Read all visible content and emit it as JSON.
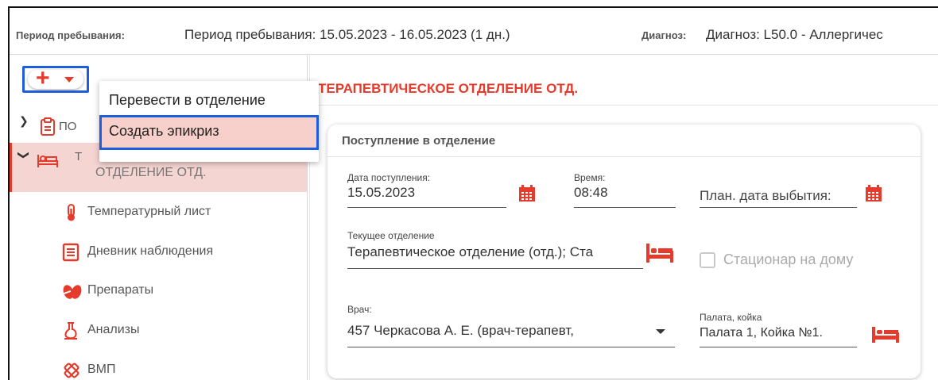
{
  "header": {
    "period_label": "Период пребывания:",
    "period_value": "Период пребывания: 15.05.2023 - 16.05.2023 (1 дн.)",
    "diagnosis_label": "Диагноз:",
    "diagnosis_value": "Диагноз: L50.0 - Аллергичес"
  },
  "toolbar": {
    "add_icon": "plus-icon",
    "dropdown_icon": "caret-down-icon"
  },
  "menu": {
    "items": [
      {
        "label": "Перевести в отделение"
      },
      {
        "label": "Создать эпикриз"
      }
    ]
  },
  "sidebar": {
    "tree": [
      {
        "label": "ПО",
        "icon": "clipboard-icon",
        "expanded": false
      },
      {
        "label_line1": "Т",
        "label_line2": "ОТДЕЛЕНИЕ ОТД.",
        "icon": "bed-icon",
        "expanded": true
      }
    ],
    "items": [
      {
        "label": "Температурный лист",
        "icon": "thermometer-icon"
      },
      {
        "label": "Дневник наблюдения",
        "icon": "journal-icon"
      },
      {
        "label": "Препараты",
        "icon": "pills-icon"
      },
      {
        "label": "Анализы",
        "icon": "flask-icon"
      },
      {
        "label": "ВМП",
        "icon": "pharmacy-icon"
      }
    ]
  },
  "main": {
    "department_title": "ТЕРАПЕВТИЧЕСКОЕ ОТДЕЛЕНИЕ ОТД.",
    "card": {
      "title": "Поступление в отделение",
      "admission_date_label": "Дата поступления:",
      "admission_date_value": "15.05.2023",
      "time_label": "Время:",
      "time_value": "08:48",
      "planned_discharge_label": "План. дата выбытия:",
      "current_department_label": "Текущее отделение",
      "current_department_value": "Терапевтическое отделение (отд.); Ста",
      "home_hospital_label": "Стационар на дому",
      "home_hospital_checked": false,
      "doctor_label": "Врач:",
      "doctor_value": "457 Черкасова А. Е. (врач-терапевт,",
      "ward_label": "Палата, койка",
      "ward_value": "Палата 1, Койка №1."
    }
  },
  "colors": {
    "accent": "#e53b2c",
    "highlight_border": "#1f5de0",
    "selected_bg": "#f5d5d2"
  }
}
